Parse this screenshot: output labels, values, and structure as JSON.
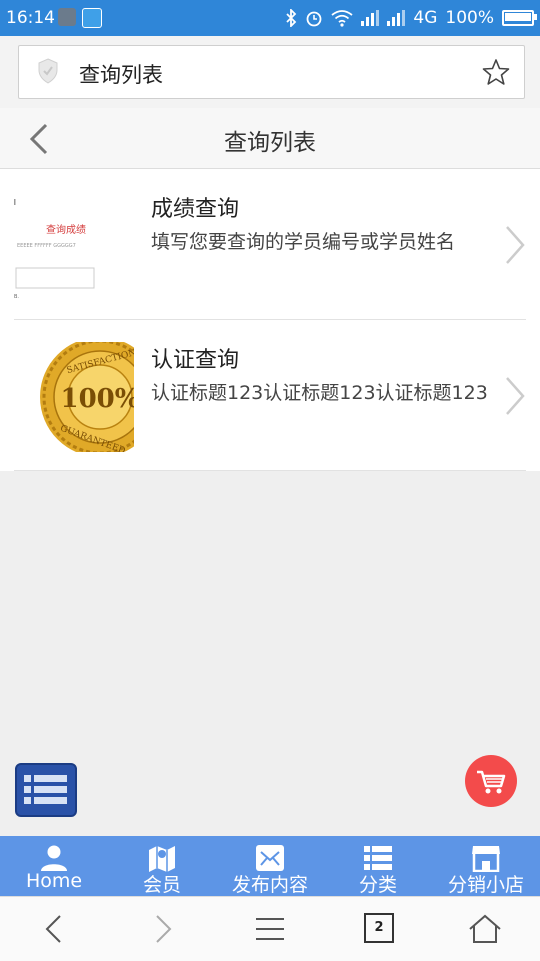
{
  "status_bar": {
    "time": "16:14",
    "network": "4G",
    "battery": "100%",
    "battery_level": 1.0,
    "icons": [
      "bluetooth-icon",
      "alarm-icon",
      "wifi-icon",
      "signal-icon",
      "signal-icon",
      "battery-icon"
    ]
  },
  "browser": {
    "url_title": "查询列表"
  },
  "header": {
    "title": "查询列表"
  },
  "list": {
    "items": [
      {
        "title": "成绩查询",
        "description": "填写您要查询的学员编号或学员姓名",
        "thumb_text": "查询成绩",
        "thumb_subtext": "EEEEE FFFFFF GGGGG7"
      },
      {
        "title": "认证查询",
        "description": "认证标题123认证标题123认证标题123",
        "seal_number": "100%",
        "seal_text_top": "SATISFACTION",
        "seal_text_bottom": "GUARANTEED"
      }
    ]
  },
  "bottom_nav": {
    "items": [
      {
        "label": "Home",
        "icon": "user-icon"
      },
      {
        "label": "会员",
        "icon": "map-icon"
      },
      {
        "label": "发布内容",
        "icon": "mail-icon"
      },
      {
        "label": "分类",
        "icon": "list-icon"
      },
      {
        "label": "分销小店",
        "icon": "store-icon"
      }
    ]
  },
  "system_nav": {
    "tab_count": "2"
  },
  "colors": {
    "status_bar": "#2f86d8",
    "bottom_nav": "#5d95e6",
    "cart_fab": "#f34b4b",
    "menu_fab": "#2a52a8"
  }
}
